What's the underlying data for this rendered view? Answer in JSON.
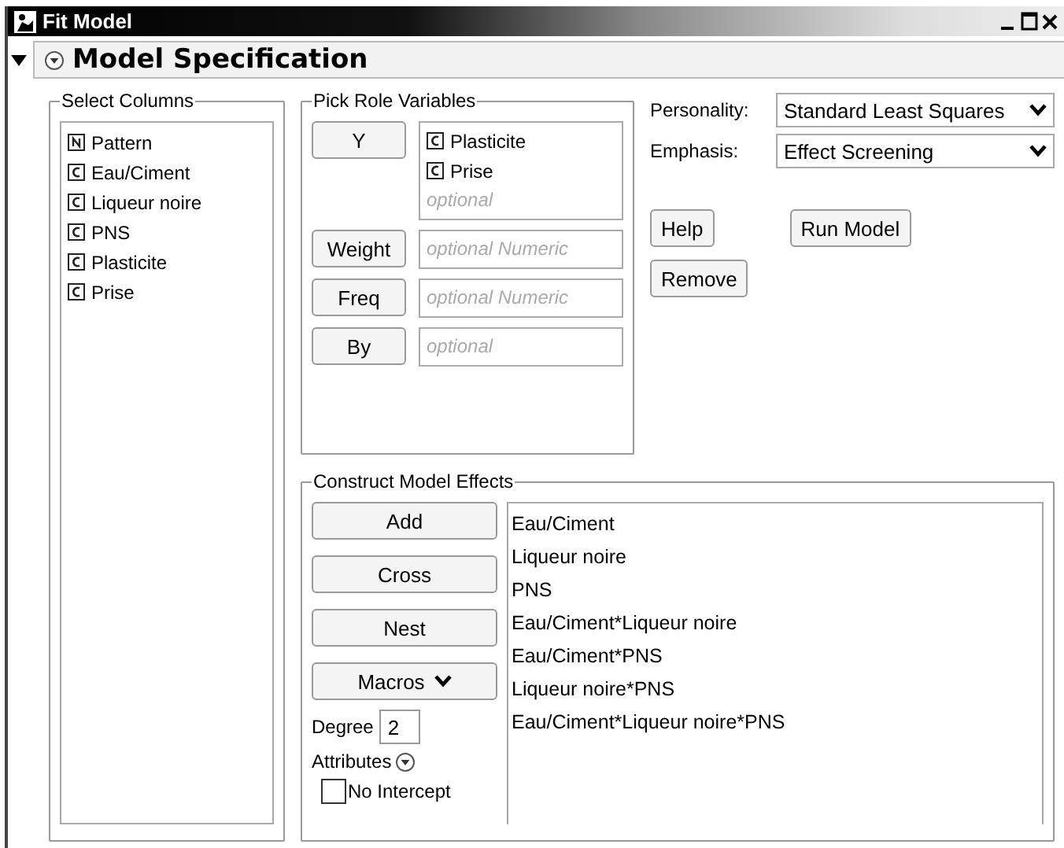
{
  "window": {
    "title": "Fit Model"
  },
  "outline": {
    "title": "Model Specification",
    "expanded": true
  },
  "select_columns": {
    "title": "Select Columns",
    "columns": [
      {
        "name": "Pattern",
        "kind": "pattern"
      },
      {
        "name": "Eau/Ciment",
        "kind": "continuous"
      },
      {
        "name": "Liqueur noire",
        "kind": "continuous"
      },
      {
        "name": "PNS",
        "kind": "continuous"
      },
      {
        "name": "Plasticite",
        "kind": "continuous"
      },
      {
        "name": "Prise",
        "kind": "continuous"
      }
    ]
  },
  "pick_roles": {
    "title": "Pick Role Variables",
    "roles": [
      {
        "button": "Y",
        "items": [
          {
            "name": "Plasticite",
            "kind": "continuous"
          },
          {
            "name": "Prise",
            "kind": "continuous"
          }
        ],
        "placeholder": "optional"
      },
      {
        "button": "Weight",
        "placeholder": "optional Numeric"
      },
      {
        "button": "Freq",
        "placeholder": "optional Numeric"
      },
      {
        "button": "By",
        "placeholder": "optional"
      }
    ]
  },
  "personality": {
    "label": "Personality:",
    "value": "Standard Least Squares"
  },
  "emphasis": {
    "label": "Emphasis:",
    "value": "Effect Screening"
  },
  "buttons": {
    "help": "Help",
    "run": "Run Model",
    "remove": "Remove"
  },
  "construct": {
    "title": "Construct Model Effects",
    "buttons": [
      "Add",
      "Cross",
      "Nest"
    ],
    "macros": "Macros",
    "degree_label": "Degree",
    "degree": "2",
    "attributes": "Attributes",
    "no_intercept": {
      "label": "No Intercept",
      "checked": false
    },
    "effects": [
      "Eau/Ciment",
      "Liqueur noire",
      "PNS",
      "Eau/Ciment*Liqueur noire",
      "Eau/Ciment*PNS",
      "Liqueur noire*PNS",
      "Eau/Ciment*Liqueur noire*PNS"
    ]
  }
}
